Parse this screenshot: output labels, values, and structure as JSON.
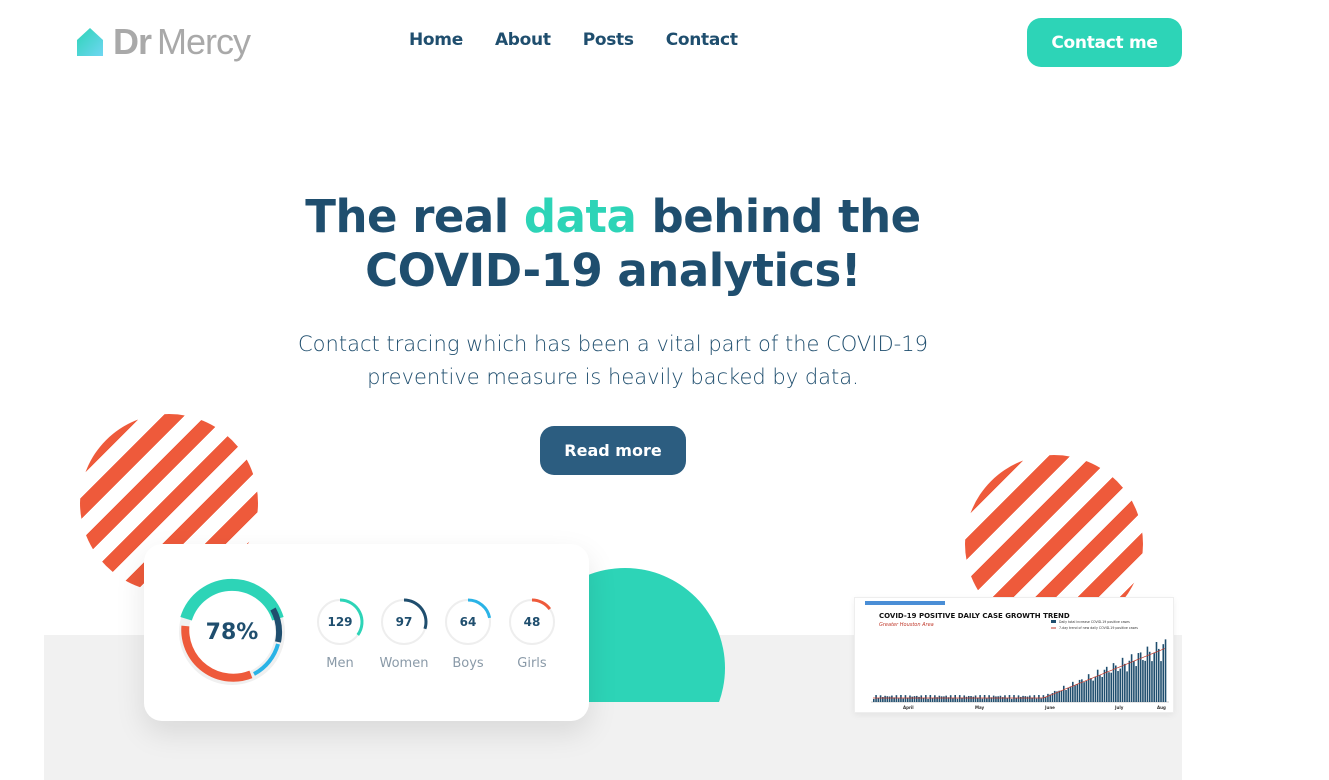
{
  "brand": {
    "strong": "Dr",
    "light": "Mercy",
    "icon": "house-icon"
  },
  "nav": {
    "items": [
      "Home",
      "About",
      "Posts",
      "Contact"
    ]
  },
  "header": {
    "cta_label": "Contact me"
  },
  "hero": {
    "title_part1": "The real ",
    "title_accent": "data",
    "title_part2": " behind the",
    "title_line2": "COVID-19 analytics!",
    "subtitle": "Contact tracing which has been a vital part of the COVID-19 preventive measure is heavily backed by data.",
    "button_label": "Read more"
  },
  "stats": {
    "main_percent_label": "78%",
    "main_percent": 0.78,
    "items": [
      {
        "value": "129",
        "label": "Men",
        "fraction": 0.35,
        "color": "#2dd4b7"
      },
      {
        "value": "97",
        "label": "Women",
        "fraction": 0.3,
        "color": "#1f4e6e"
      },
      {
        "value": "64",
        "label": "Boys",
        "fraction": 0.22,
        "color": "#2ab3e6"
      },
      {
        "value": "48",
        "label": "Girls",
        "fraction": 0.15,
        "color": "#ee5a3b"
      }
    ]
  },
  "thumbnail": {
    "title": "COVID-19 POSITIVE DAILY CASE GROWTH TREND",
    "subtitle": "Greater Houston Area",
    "legend": [
      "Daily total increase COVID-19 positive cases",
      "7-day trend of new daily COVID-19 positive cases"
    ],
    "months": [
      "April",
      "May",
      "June",
      "July",
      "Aug"
    ]
  },
  "colors": {
    "teal": "#2dd4b7",
    "navy": "#1f4e6e",
    "coral": "#ee5a3b",
    "button_blue": "#2c5d80"
  }
}
